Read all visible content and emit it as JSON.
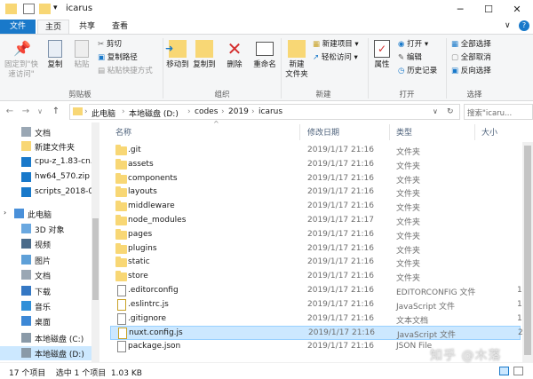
{
  "window": {
    "title": "icarus"
  },
  "tabs": {
    "file": "文件",
    "home": "主页",
    "share": "共享",
    "view": "查看"
  },
  "ribbon": {
    "pin_quick_access": "固定到\"快\n速访问\"",
    "copy": "复制",
    "paste": "粘贴",
    "cut": "剪切",
    "copy_path": "复制路径",
    "paste_shortcut": "粘贴快捷方式",
    "clipboard_label": "剪贴板",
    "move_to": "移动到",
    "copy_to": "复制到",
    "delete": "删除",
    "rename": "重命名",
    "organize_label": "组织",
    "new_folder": "新建\n文件夹",
    "new_item": "新建项目 ▾",
    "easy_access": "轻松访问 ▾",
    "new_label": "新建",
    "properties": "属性",
    "open": "打开 ▾",
    "edit": "编辑",
    "history": "历史记录",
    "open_label": "打开",
    "select_all": "全部选择",
    "select_none": "全部取消",
    "invert_selection": "反向选择",
    "select_label": "选择"
  },
  "address": {
    "crumbs": [
      "此电脑",
      "本地磁盘 (D:)",
      "codes",
      "2019",
      "icarus"
    ],
    "search_placeholder": "搜索\"icaru..."
  },
  "navpane": {
    "items": [
      {
        "label": "文档",
        "icon": "documents-icon"
      },
      {
        "label": "新建文件夹",
        "icon": "folder-icon"
      },
      {
        "label": "cpu-z_1.83-cn.z",
        "icon": "zip-icon"
      },
      {
        "label": "hw64_570.zip",
        "icon": "zip-icon"
      },
      {
        "label": "scripts_2018-02",
        "icon": "zip-icon"
      },
      {
        "label": "此电脑",
        "icon": "this-pc-icon"
      },
      {
        "label": "3D 对象",
        "icon": "3d-objects-icon"
      },
      {
        "label": "视频",
        "icon": "videos-icon"
      },
      {
        "label": "图片",
        "icon": "pictures-icon"
      },
      {
        "label": "文档",
        "icon": "documents-icon"
      },
      {
        "label": "下载",
        "icon": "downloads-icon"
      },
      {
        "label": "音乐",
        "icon": "music-icon"
      },
      {
        "label": "桌面",
        "icon": "desktop-icon"
      },
      {
        "label": "本地磁盘 (C:)",
        "icon": "drive-icon"
      },
      {
        "label": "本地磁盘 (D:)",
        "icon": "drive-icon"
      }
    ]
  },
  "filelist": {
    "columns": {
      "name": "名称",
      "modified": "修改日期",
      "type": "类型",
      "size": "大小"
    },
    "rows": [
      {
        "name": ".git",
        "modified": "2019/1/17 21:16",
        "type": "文件夹",
        "size": "",
        "kind": "folder"
      },
      {
        "name": "assets",
        "modified": "2019/1/17 21:16",
        "type": "文件夹",
        "size": "",
        "kind": "folder"
      },
      {
        "name": "components",
        "modified": "2019/1/17 21:16",
        "type": "文件夹",
        "size": "",
        "kind": "folder"
      },
      {
        "name": "layouts",
        "modified": "2019/1/17 21:16",
        "type": "文件夹",
        "size": "",
        "kind": "folder"
      },
      {
        "name": "middleware",
        "modified": "2019/1/17 21:16",
        "type": "文件夹",
        "size": "",
        "kind": "folder"
      },
      {
        "name": "node_modules",
        "modified": "2019/1/17 21:17",
        "type": "文件夹",
        "size": "",
        "kind": "folder"
      },
      {
        "name": "pages",
        "modified": "2019/1/17 21:16",
        "type": "文件夹",
        "size": "",
        "kind": "folder"
      },
      {
        "name": "plugins",
        "modified": "2019/1/17 21:16",
        "type": "文件夹",
        "size": "",
        "kind": "folder"
      },
      {
        "name": "static",
        "modified": "2019/1/17 21:16",
        "type": "文件夹",
        "size": "",
        "kind": "folder"
      },
      {
        "name": "store",
        "modified": "2019/1/17 21:16",
        "type": "文件夹",
        "size": "",
        "kind": "folder"
      },
      {
        "name": ".editorconfig",
        "modified": "2019/1/17 21:16",
        "type": "EDITORCONFIG 文件",
        "size": "1",
        "kind": "file"
      },
      {
        "name": ".eslintrc.js",
        "modified": "2019/1/17 21:16",
        "type": "JavaScript 文件",
        "size": "1",
        "kind": "js"
      },
      {
        "name": ".gitignore",
        "modified": "2019/1/17 21:16",
        "type": "文本文档",
        "size": "1",
        "kind": "file"
      },
      {
        "name": "nuxt.config.js",
        "modified": "2019/1/17 21:16",
        "type": "JavaScript 文件",
        "size": "2",
        "kind": "js"
      },
      {
        "name": "package.json",
        "modified": "2019/1/17 21:16",
        "type": "JSON File",
        "size": "",
        "kind": "file"
      }
    ]
  },
  "status": {
    "text": "17 个项目    选中 1 个项目  1.03 KB"
  },
  "watermark": "知乎 @木落",
  "colors": {
    "accent": "#1979ca",
    "selection": "#cce8ff",
    "folder": "#f8d775"
  }
}
